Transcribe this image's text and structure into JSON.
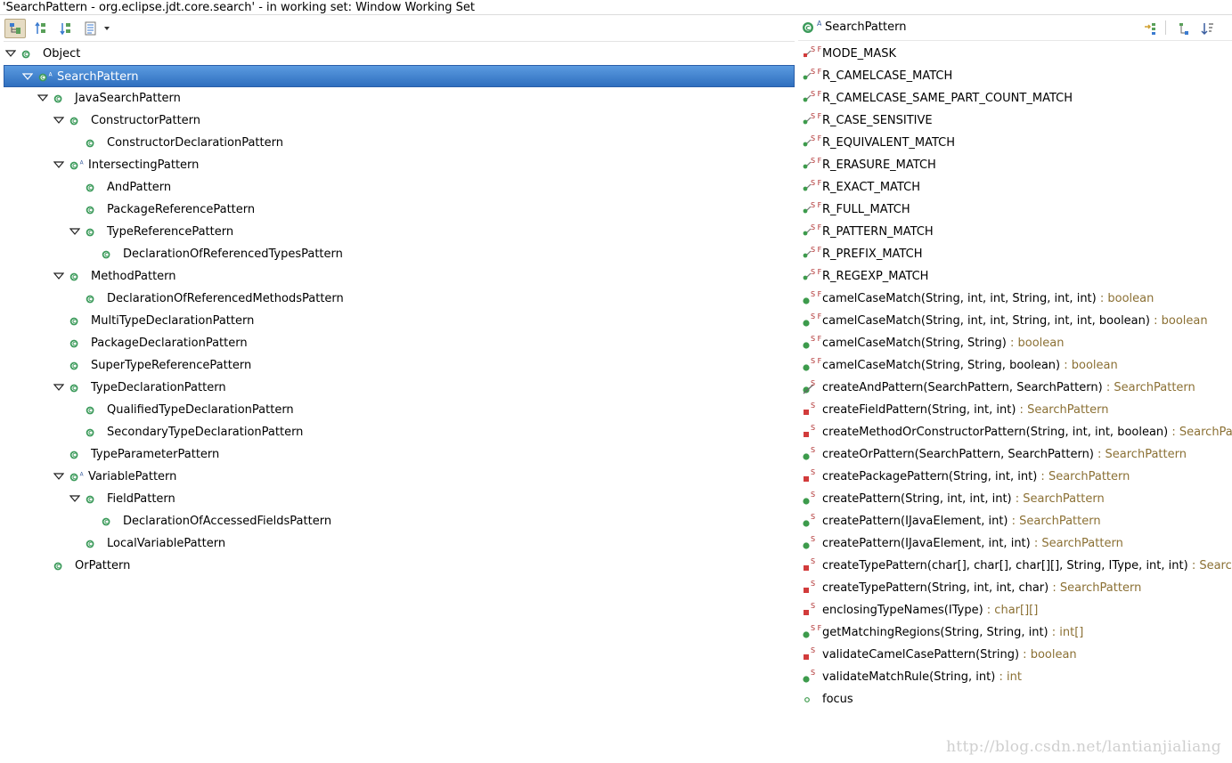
{
  "window": {
    "title": "'SearchPattern - org.eclipse.jdt.core.search' - in working set: Window Working Set"
  },
  "toolbar": {
    "buttons": [
      {
        "name": "show-type-hierarchy",
        "active": true
      },
      {
        "name": "show-supertype-hierarchy",
        "active": false
      },
      {
        "name": "show-subtype-hierarchy",
        "active": false
      },
      {
        "name": "layout-menu",
        "active": false
      }
    ],
    "dropdown_icon": "chevron-down-icon"
  },
  "hierarchy": [
    {
      "label": "Object",
      "depth": 0,
      "expanded": true,
      "abstract": false,
      "selected": false
    },
    {
      "label": "SearchPattern",
      "depth": 1,
      "expanded": true,
      "abstract": true,
      "selected": true
    },
    {
      "label": "JavaSearchPattern",
      "depth": 2,
      "expanded": true,
      "abstract": false,
      "selected": false
    },
    {
      "label": "ConstructorPattern",
      "depth": 3,
      "expanded": true,
      "abstract": false,
      "selected": false
    },
    {
      "label": "ConstructorDeclarationPattern",
      "depth": 4,
      "expanded": null,
      "abstract": false,
      "selected": false
    },
    {
      "label": "IntersectingPattern",
      "depth": 3,
      "expanded": true,
      "abstract": true,
      "selected": false
    },
    {
      "label": "AndPattern",
      "depth": 4,
      "expanded": null,
      "abstract": false,
      "selected": false
    },
    {
      "label": "PackageReferencePattern",
      "depth": 4,
      "expanded": null,
      "abstract": false,
      "selected": false
    },
    {
      "label": "TypeReferencePattern",
      "depth": 4,
      "expanded": true,
      "abstract": false,
      "selected": false
    },
    {
      "label": "DeclarationOfReferencedTypesPattern",
      "depth": 5,
      "expanded": null,
      "abstract": false,
      "selected": false
    },
    {
      "label": "MethodPattern",
      "depth": 3,
      "expanded": true,
      "abstract": false,
      "selected": false
    },
    {
      "label": "DeclarationOfReferencedMethodsPattern",
      "depth": 4,
      "expanded": null,
      "abstract": false,
      "selected": false
    },
    {
      "label": "MultiTypeDeclarationPattern",
      "depth": 3,
      "expanded": null,
      "abstract": false,
      "selected": false
    },
    {
      "label": "PackageDeclarationPattern",
      "depth": 3,
      "expanded": null,
      "abstract": false,
      "selected": false
    },
    {
      "label": "SuperTypeReferencePattern",
      "depth": 3,
      "expanded": null,
      "abstract": false,
      "selected": false
    },
    {
      "label": "TypeDeclarationPattern",
      "depth": 3,
      "expanded": true,
      "abstract": false,
      "selected": false
    },
    {
      "label": "QualifiedTypeDeclarationPattern",
      "depth": 4,
      "expanded": null,
      "abstract": false,
      "selected": false
    },
    {
      "label": "SecondaryTypeDeclarationPattern",
      "depth": 4,
      "expanded": null,
      "abstract": false,
      "selected": false
    },
    {
      "label": "TypeParameterPattern",
      "depth": 3,
      "expanded": null,
      "abstract": false,
      "selected": false
    },
    {
      "label": "VariablePattern",
      "depth": 3,
      "expanded": true,
      "abstract": true,
      "selected": false
    },
    {
      "label": "FieldPattern",
      "depth": 4,
      "expanded": true,
      "abstract": false,
      "selected": false
    },
    {
      "label": "DeclarationOfAccessedFieldsPattern",
      "depth": 5,
      "expanded": null,
      "abstract": false,
      "selected": false
    },
    {
      "label": "LocalVariablePattern",
      "depth": 4,
      "expanded": null,
      "abstract": false,
      "selected": false
    },
    {
      "label": "OrPattern",
      "depth": 2,
      "expanded": null,
      "abstract": false,
      "selected": false
    }
  ],
  "members_panel": {
    "title": "SearchPattern",
    "title_badge": "A",
    "members": [
      {
        "name": "MODE_MASK",
        "type": "",
        "visibility": "private",
        "mods": "SF",
        "icon": "private-field-icon"
      },
      {
        "name": "R_CAMELCASE_MATCH",
        "type": "",
        "visibility": "public",
        "mods": "SF",
        "icon": "public-field-icon"
      },
      {
        "name": "R_CAMELCASE_SAME_PART_COUNT_MATCH",
        "type": "",
        "visibility": "public",
        "mods": "SF",
        "icon": "public-field-icon"
      },
      {
        "name": "R_CASE_SENSITIVE",
        "type": "",
        "visibility": "public",
        "mods": "SF",
        "icon": "public-field-icon"
      },
      {
        "name": "R_EQUIVALENT_MATCH",
        "type": "",
        "visibility": "public",
        "mods": "SF",
        "icon": "public-field-icon"
      },
      {
        "name": "R_ERASURE_MATCH",
        "type": "",
        "visibility": "public",
        "mods": "SF",
        "icon": "public-field-icon"
      },
      {
        "name": "R_EXACT_MATCH",
        "type": "",
        "visibility": "public",
        "mods": "SF",
        "icon": "public-field-icon"
      },
      {
        "name": "R_FULL_MATCH",
        "type": "",
        "visibility": "public",
        "mods": "SF",
        "icon": "public-field-icon"
      },
      {
        "name": "R_PATTERN_MATCH",
        "type": "",
        "visibility": "public",
        "mods": "SF",
        "icon": "public-field-icon"
      },
      {
        "name": "R_PREFIX_MATCH",
        "type": "",
        "visibility": "public",
        "mods": "SF",
        "icon": "public-field-icon"
      },
      {
        "name": "R_REGEXP_MATCH",
        "type": "",
        "visibility": "public",
        "mods": "SF",
        "icon": "public-field-icon"
      },
      {
        "name": "camelCaseMatch(String, int, int, String, int, int)",
        "type": " : boolean",
        "visibility": "public",
        "mods": "SF",
        "icon": "public-method-icon"
      },
      {
        "name": "camelCaseMatch(String, int, int, String, int, int, boolean)",
        "type": " : boolean",
        "visibility": "public",
        "mods": "SF",
        "icon": "public-method-icon"
      },
      {
        "name": "camelCaseMatch(String, String)",
        "type": " : boolean",
        "visibility": "public",
        "mods": "SF",
        "icon": "public-method-icon"
      },
      {
        "name": "camelCaseMatch(String, String, boolean)",
        "type": " : boolean",
        "visibility": "public",
        "mods": "SF",
        "icon": "public-method-icon"
      },
      {
        "name": "createAndPattern(SearchPattern, SearchPattern)",
        "type": " : SearchPattern",
        "visibility": "public",
        "mods": "S",
        "icon": "deprecated-method-icon"
      },
      {
        "name": "createFieldPattern(String, int, int)",
        "type": " : SearchPattern",
        "visibility": "private",
        "mods": "S",
        "icon": "private-method-icon"
      },
      {
        "name": "createMethodOrConstructorPattern(String, int, int, boolean)",
        "type": " : SearchPattern",
        "visibility": "private",
        "mods": "S",
        "icon": "private-method-icon"
      },
      {
        "name": "createOrPattern(SearchPattern, SearchPattern)",
        "type": " : SearchPattern",
        "visibility": "public",
        "mods": "S",
        "icon": "public-method-icon"
      },
      {
        "name": "createPackagePattern(String, int, int)",
        "type": " : SearchPattern",
        "visibility": "private",
        "mods": "S",
        "icon": "private-method-icon"
      },
      {
        "name": "createPattern(String, int, int, int)",
        "type": " : SearchPattern",
        "visibility": "public",
        "mods": "S",
        "icon": "public-method-icon"
      },
      {
        "name": "createPattern(IJavaElement, int)",
        "type": " : SearchPattern",
        "visibility": "public",
        "mods": "S",
        "icon": "public-method-icon"
      },
      {
        "name": "createPattern(IJavaElement, int, int)",
        "type": " : SearchPattern",
        "visibility": "public",
        "mods": "S",
        "icon": "public-method-icon"
      },
      {
        "name": "createTypePattern(char[], char[], char[][], String, IType, int, int)",
        "type": " : SearchPattern",
        "visibility": "private",
        "mods": "S",
        "icon": "private-method-icon"
      },
      {
        "name": "createTypePattern(String, int, int, char)",
        "type": " : SearchPattern",
        "visibility": "private",
        "mods": "S",
        "icon": "private-method-icon"
      },
      {
        "name": "enclosingTypeNames(IType)",
        "type": " : char[][]",
        "visibility": "private",
        "mods": "S",
        "icon": "private-method-icon"
      },
      {
        "name": "getMatchingRegions(String, String, int)",
        "type": " : int[]",
        "visibility": "public",
        "mods": "SF",
        "icon": "public-method-icon"
      },
      {
        "name": "validateCamelCasePattern(String)",
        "type": " : boolean",
        "visibility": "private",
        "mods": "S",
        "icon": "private-method-icon"
      },
      {
        "name": "validateMatchRule(String, int)",
        "type": " : int",
        "visibility": "public",
        "mods": "S",
        "icon": "public-method-icon"
      },
      {
        "name": "focus",
        "type": "",
        "visibility": "package",
        "mods": "",
        "icon": "package-field-icon"
      }
    ]
  },
  "watermark": "http://blog.csdn.net/lantianjialiang",
  "colors": {
    "selection": "#3a78c8",
    "class_icon": "#3b9a5a",
    "public_member": "#3d9b4c",
    "private_member": "#d23b3b",
    "return_type": "#8b7034"
  }
}
